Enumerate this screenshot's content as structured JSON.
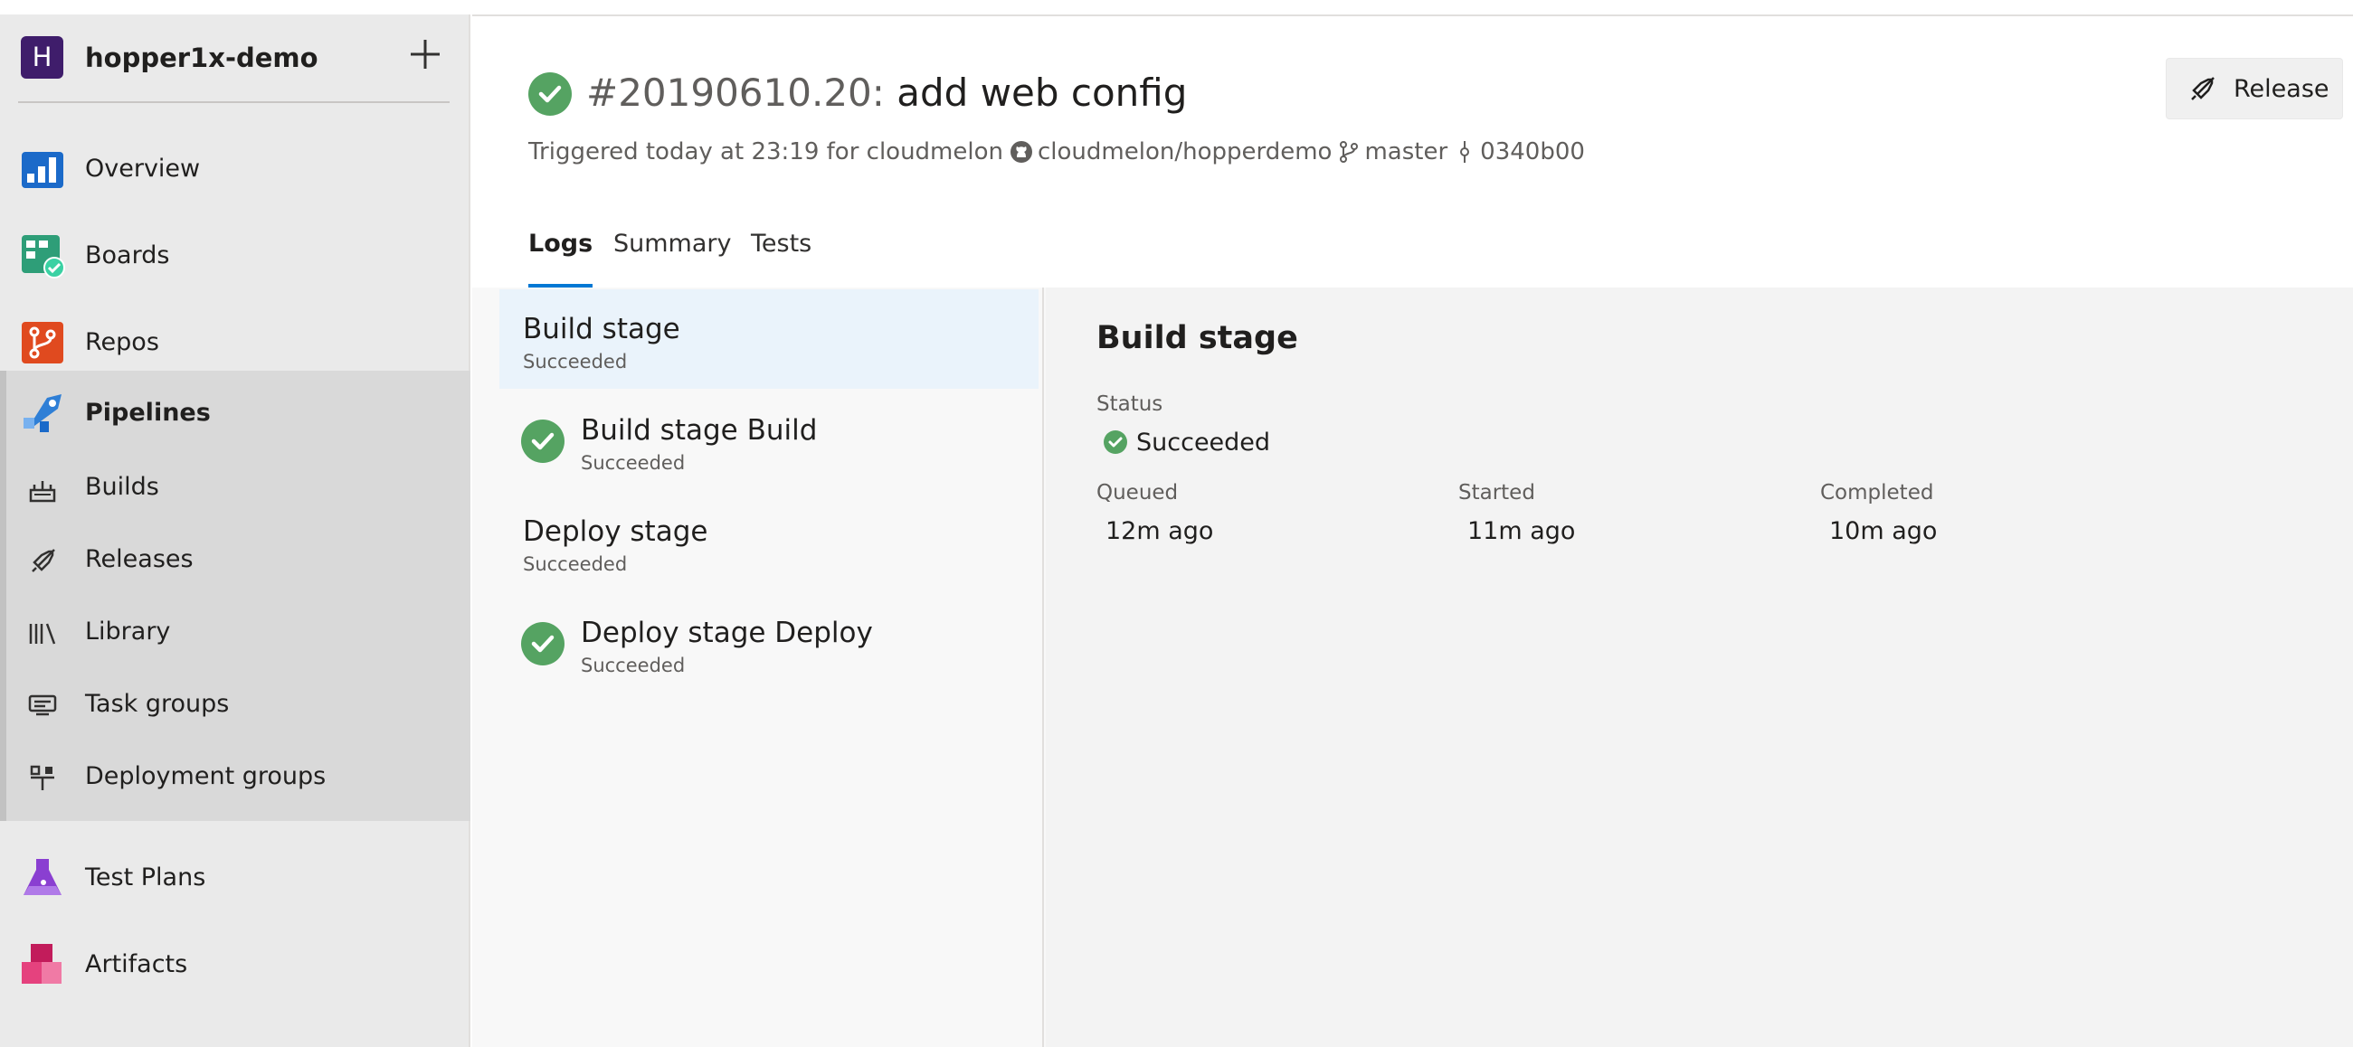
{
  "sidebar": {
    "org_initial": "H",
    "org_name": "hopper1x-demo",
    "items": [
      {
        "label": "Overview"
      },
      {
        "label": "Boards"
      },
      {
        "label": "Repos"
      },
      {
        "label": "Pipelines"
      },
      {
        "label": "Test Plans"
      },
      {
        "label": "Artifacts"
      }
    ],
    "pipelines_sub": [
      {
        "label": "Builds"
      },
      {
        "label": "Releases"
      },
      {
        "label": "Library"
      },
      {
        "label": "Task groups"
      },
      {
        "label": "Deployment groups"
      }
    ]
  },
  "run": {
    "number": "#20190610.20:",
    "message": "add web config",
    "triggered": "Triggered today at 23:19 for cloudmelon",
    "repo": "cloudmelon/hopperdemo",
    "branch": "master",
    "commit": "0340b00",
    "release_label": "Release"
  },
  "tabs": [
    {
      "label": "Logs"
    },
    {
      "label": "Summary"
    },
    {
      "label": "Tests"
    }
  ],
  "stages": [
    {
      "title": "Build stage",
      "status": "Succeeded"
    },
    {
      "title": "Build stage Build",
      "status": "Succeeded"
    },
    {
      "title": "Deploy stage",
      "status": "Succeeded"
    },
    {
      "title": "Deploy stage Deploy",
      "status": "Succeeded"
    }
  ],
  "detail": {
    "title": "Build stage",
    "status_label": "Status",
    "status_value": "Succeeded",
    "queued_label": "Queued",
    "queued_value": "12m ago",
    "started_label": "Started",
    "started_value": "11m ago",
    "completed_label": "Completed",
    "completed_value": "10m ago"
  },
  "colors": {
    "accent": "#0078d4",
    "success": "#55a362",
    "org_avatar": "#3f1d6b"
  }
}
